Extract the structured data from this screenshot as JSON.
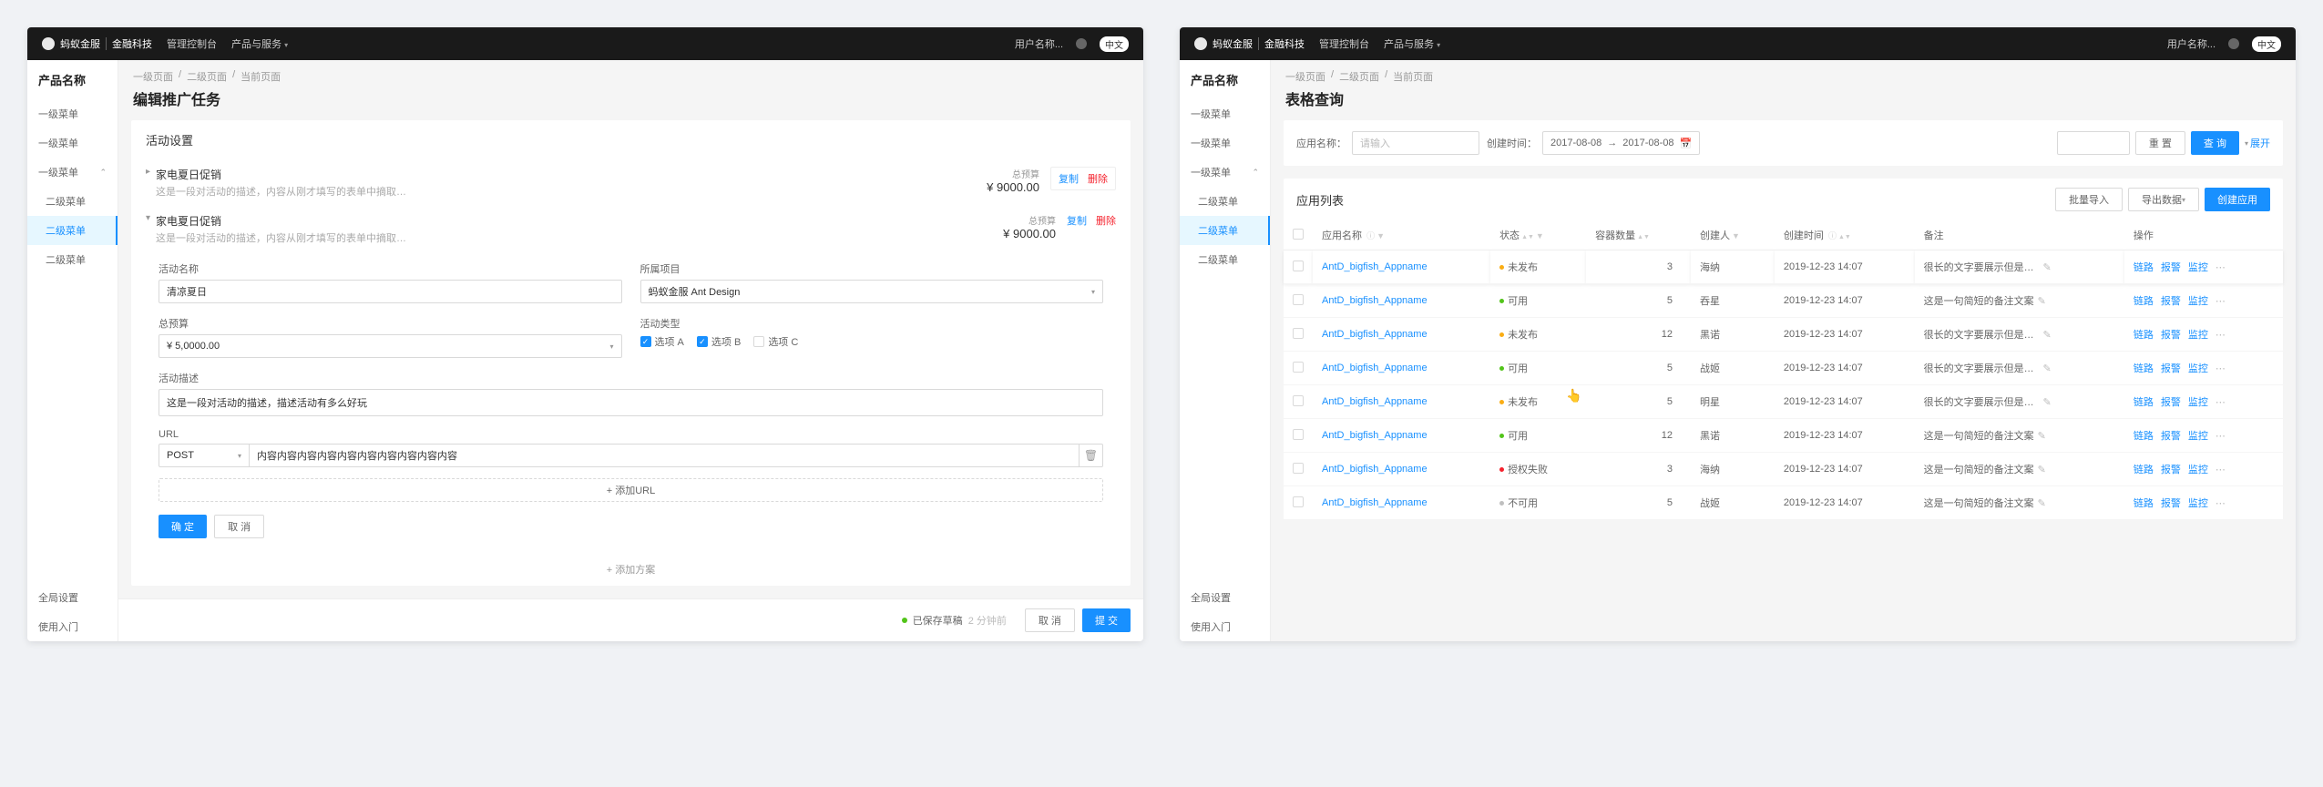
{
  "topbar": {
    "brand_main": "蚂蚁金服",
    "brand_sub": "金融科技",
    "nav_console": "管理控制台",
    "nav_products": "产品与服务",
    "user": "用户名称...",
    "badge": "中文"
  },
  "sidebar": {
    "product": "产品名称",
    "level1_a": "一级菜单",
    "level1_b": "一级菜单",
    "level1_c": "一级菜单",
    "level2_a": "二级菜单",
    "level2_b": "二级菜单",
    "level2_c": "二级菜单",
    "global": "全局设置",
    "getting_started": "使用入门"
  },
  "left": {
    "breadcrumb_l1": "一级页面",
    "breadcrumb_l2": "二级页面",
    "breadcrumb_cur": "当前页面",
    "title": "编辑推广任务",
    "section_header": "活动设置",
    "promo_title": "家电夏日促销",
    "promo_desc": "这是一段对活动的描述，内容从刚才填写的表单中摘取…",
    "budget_label": "总预算",
    "budget_value": "¥ 9000.00",
    "action_copy": "复制",
    "action_delete": "删除",
    "form": {
      "name_label": "活动名称",
      "name_value": "清凉夏日",
      "project_label": "所属项目",
      "project_value": "蚂蚁金服 Ant Design",
      "budget_label": "总预算",
      "budget_value": "¥ 5,0000.00",
      "type_label": "活动类型",
      "opt_a": "选项 A",
      "opt_b": "选项 B",
      "opt_c": "选项 C",
      "desc_label": "活动描述",
      "desc_value": "这是一段对活动的描述，描述活动有多么好玩",
      "url_label": "URL",
      "url_method": "POST",
      "url_value": "内容内容内容内容内容内容内容内容内容内容",
      "add_url": "+  添加URL",
      "confirm": "确 定",
      "cancel": "取 消"
    },
    "add_scheme": "+  添加方案",
    "footer": {
      "save_status": "已保存草稿",
      "save_time": "2 分钟前",
      "cancel": "取 消",
      "submit": "提 交"
    }
  },
  "right": {
    "breadcrumb_l1": "一级页面",
    "breadcrumb_l2": "二级页面",
    "breadcrumb_cur": "当前页面",
    "title": "表格查询",
    "search": {
      "app_label": "应用名称：",
      "app_placeholder": "请输入",
      "time_label": "创建时间：",
      "date_from": "2017-08-08",
      "date_to": "2017-08-08",
      "reset": "重 置",
      "query": "查 询",
      "expand": "展开"
    },
    "table": {
      "title": "应用列表",
      "btn_import": "批量导入",
      "btn_export": "导出数据",
      "btn_create": "创建应用",
      "col_name": "应用名称",
      "col_status": "状态",
      "col_count": "容器数量",
      "col_creator": "创建人",
      "col_time": "创建时间",
      "col_note": "备注",
      "col_op": "操作",
      "op_link": "链路",
      "op_alarm": "报警",
      "op_monitor": "监控",
      "app_name": "AntD_bigfish_Appname",
      "status_unpub": "未发布",
      "status_avail": "可用",
      "status_auth_fail": "授权失败",
      "status_unavail": "不可用",
      "note_long": "很长的文字要展示但是要留下…尾巴",
      "note_short": "这是一句简短的备注文案",
      "time": "2019-12-23 14:07",
      "creators": [
        "海纳",
        "吞星",
        "黑诺",
        "战姬",
        "明星",
        "黑诺",
        "海纳",
        "战姬"
      ],
      "counts": [
        3,
        5,
        12,
        5,
        5,
        12,
        3,
        5
      ],
      "statuses": [
        "unpub",
        "avail",
        "unpub",
        "avail",
        "unpub",
        "avail",
        "auth_fail",
        "unavail"
      ],
      "notes": [
        "long",
        "short",
        "long",
        "long",
        "long",
        "short",
        "short",
        "short"
      ]
    }
  }
}
